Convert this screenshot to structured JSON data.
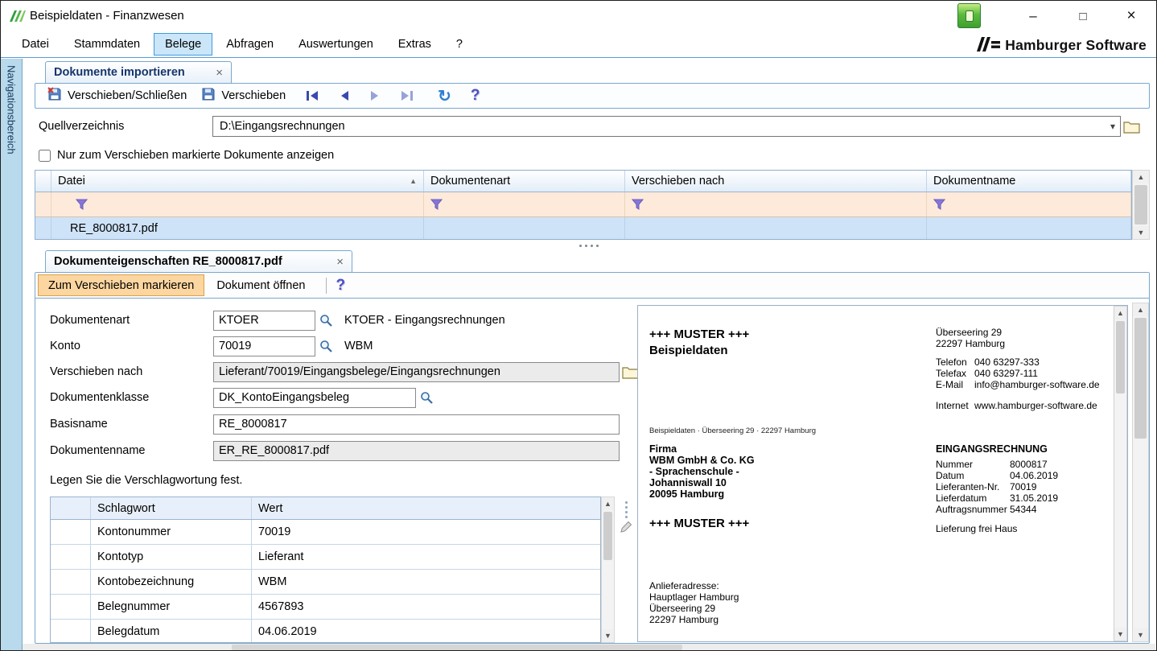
{
  "window": {
    "title": "Beispieldaten - Finanzwesen",
    "controls": {
      "minimize": "–",
      "maximize": "□",
      "close": "×"
    }
  },
  "menubar": {
    "items": [
      "Datei",
      "Stammdaten",
      "Belege",
      "Abfragen",
      "Auswertungen",
      "Extras",
      "?"
    ],
    "active_item": "Belege",
    "brand": "Hamburger Software"
  },
  "sidebar": {
    "label": "Navigationsbereich"
  },
  "tabs": {
    "main": "Dokumente importieren",
    "properties": "Dokumenteigenschaften RE_8000817.pdf"
  },
  "icons": {
    "tab_close": "×",
    "refresh": "↻",
    "help": "?",
    "sort_asc": "▲",
    "dropdown": "▾",
    "scroll_up": "▲",
    "scroll_down": "▼"
  },
  "toolbar": {
    "move_close": "Verschieben/Schließen",
    "move": "Verschieben"
  },
  "source": {
    "label": "Quellverzeichnis",
    "value": "D:\\Eingangsrechnungen"
  },
  "filter": {
    "checkbox_label": "Nur zum Verschieben markierte Dokumente anzeigen"
  },
  "documents": {
    "columns": {
      "datei": "Datei",
      "dokumentenart": "Dokumentenart",
      "verschieben_nach": "Verschieben nach",
      "dokumentname": "Dokumentname"
    },
    "rows": [
      {
        "datei": "RE_8000817.pdf",
        "dokumentenart": "",
        "verschieben_nach": "",
        "dokumentname": ""
      }
    ]
  },
  "properties": {
    "actions": {
      "mark": "Zum Verschieben markieren",
      "open": "Dokument öffnen"
    },
    "fields": {
      "dokumentenart": {
        "label": "Dokumentenart",
        "value": "KTOER",
        "info": "KTOER - Eingangsrechnungen"
      },
      "konto": {
        "label": "Konto",
        "value": "70019",
        "info": "WBM"
      },
      "verschieben_nach": {
        "label": "Verschieben nach",
        "value": "Lieferant/70019/Eingangsbelege/Eingangsrechnungen"
      },
      "dokumentenklasse": {
        "label": "Dokumentenklasse",
        "value": "DK_KontoEingangsbeleg"
      },
      "basisname": {
        "label": "Basisname",
        "value": "RE_8000817"
      },
      "dokumentenname": {
        "label": "Dokumentenname",
        "value": "ER_RE_8000817.pdf"
      }
    },
    "keywords": {
      "heading": "Legen Sie die Verschlagwortung fest.",
      "columns": {
        "schlagwort": "Schlagwort",
        "wert": "Wert"
      },
      "rows": [
        {
          "schlagwort": "Kontonummer",
          "wert": "70019"
        },
        {
          "schlagwort": "Kontotyp",
          "wert": "Lieferant"
        },
        {
          "schlagwort": "Kontobezeichnung",
          "wert": "WBM"
        },
        {
          "schlagwort": "Belegnummer",
          "wert": "4567893"
        },
        {
          "schlagwort": "Belegdatum",
          "wert": "04.06.2019"
        }
      ]
    }
  },
  "preview": {
    "muster_top_line1": "+++ MUSTER +++",
    "muster_top_line2": "Beispieldaten",
    "address": [
      "Überseering 29",
      "22297 Hamburg"
    ],
    "contact": [
      {
        "label": "Telefon",
        "value": "040 63297-333"
      },
      {
        "label": "Telefax",
        "value": "040 63297-111"
      },
      {
        "label": "E-Mail",
        "value": "info@hamburger-software.de"
      },
      {
        "label": "Internet",
        "value": "www.hamburger-software.de"
      }
    ],
    "sender_line": "Beispieldaten · Überseering 29 · 22297 Hamburg",
    "recipient": [
      "Firma",
      "WBM GmbH & Co. KG",
      "- Sprachenschule -",
      "Johanniswall 10",
      "20095 Hamburg"
    ],
    "invoice": {
      "heading": "EINGANGSRECHNUNG",
      "rows": [
        {
          "label": "Nummer",
          "value": "8000817"
        },
        {
          "label": "Datum",
          "value": "04.06.2019"
        },
        {
          "label": "Lieferanten-Nr.",
          "value": "70019"
        },
        {
          "label": "Lieferdatum",
          "value": "31.05.2019"
        },
        {
          "label": "Auftragsnummer",
          "value": "54344"
        }
      ],
      "note": "Lieferung frei Haus"
    },
    "muster_mid": "+++ MUSTER +++",
    "delivery": [
      "Anlieferadresse:",
      "Hauptlager Hamburg",
      "Überseering 29",
      "22297 Hamburg"
    ]
  },
  "colors": {
    "frame_blue": "#7ba7cc",
    "selection_blue": "#cfe3f8",
    "filter_peach": "#fdeada",
    "highlight_orange": "#fcd6a0",
    "brand_green": "#3fae49"
  }
}
